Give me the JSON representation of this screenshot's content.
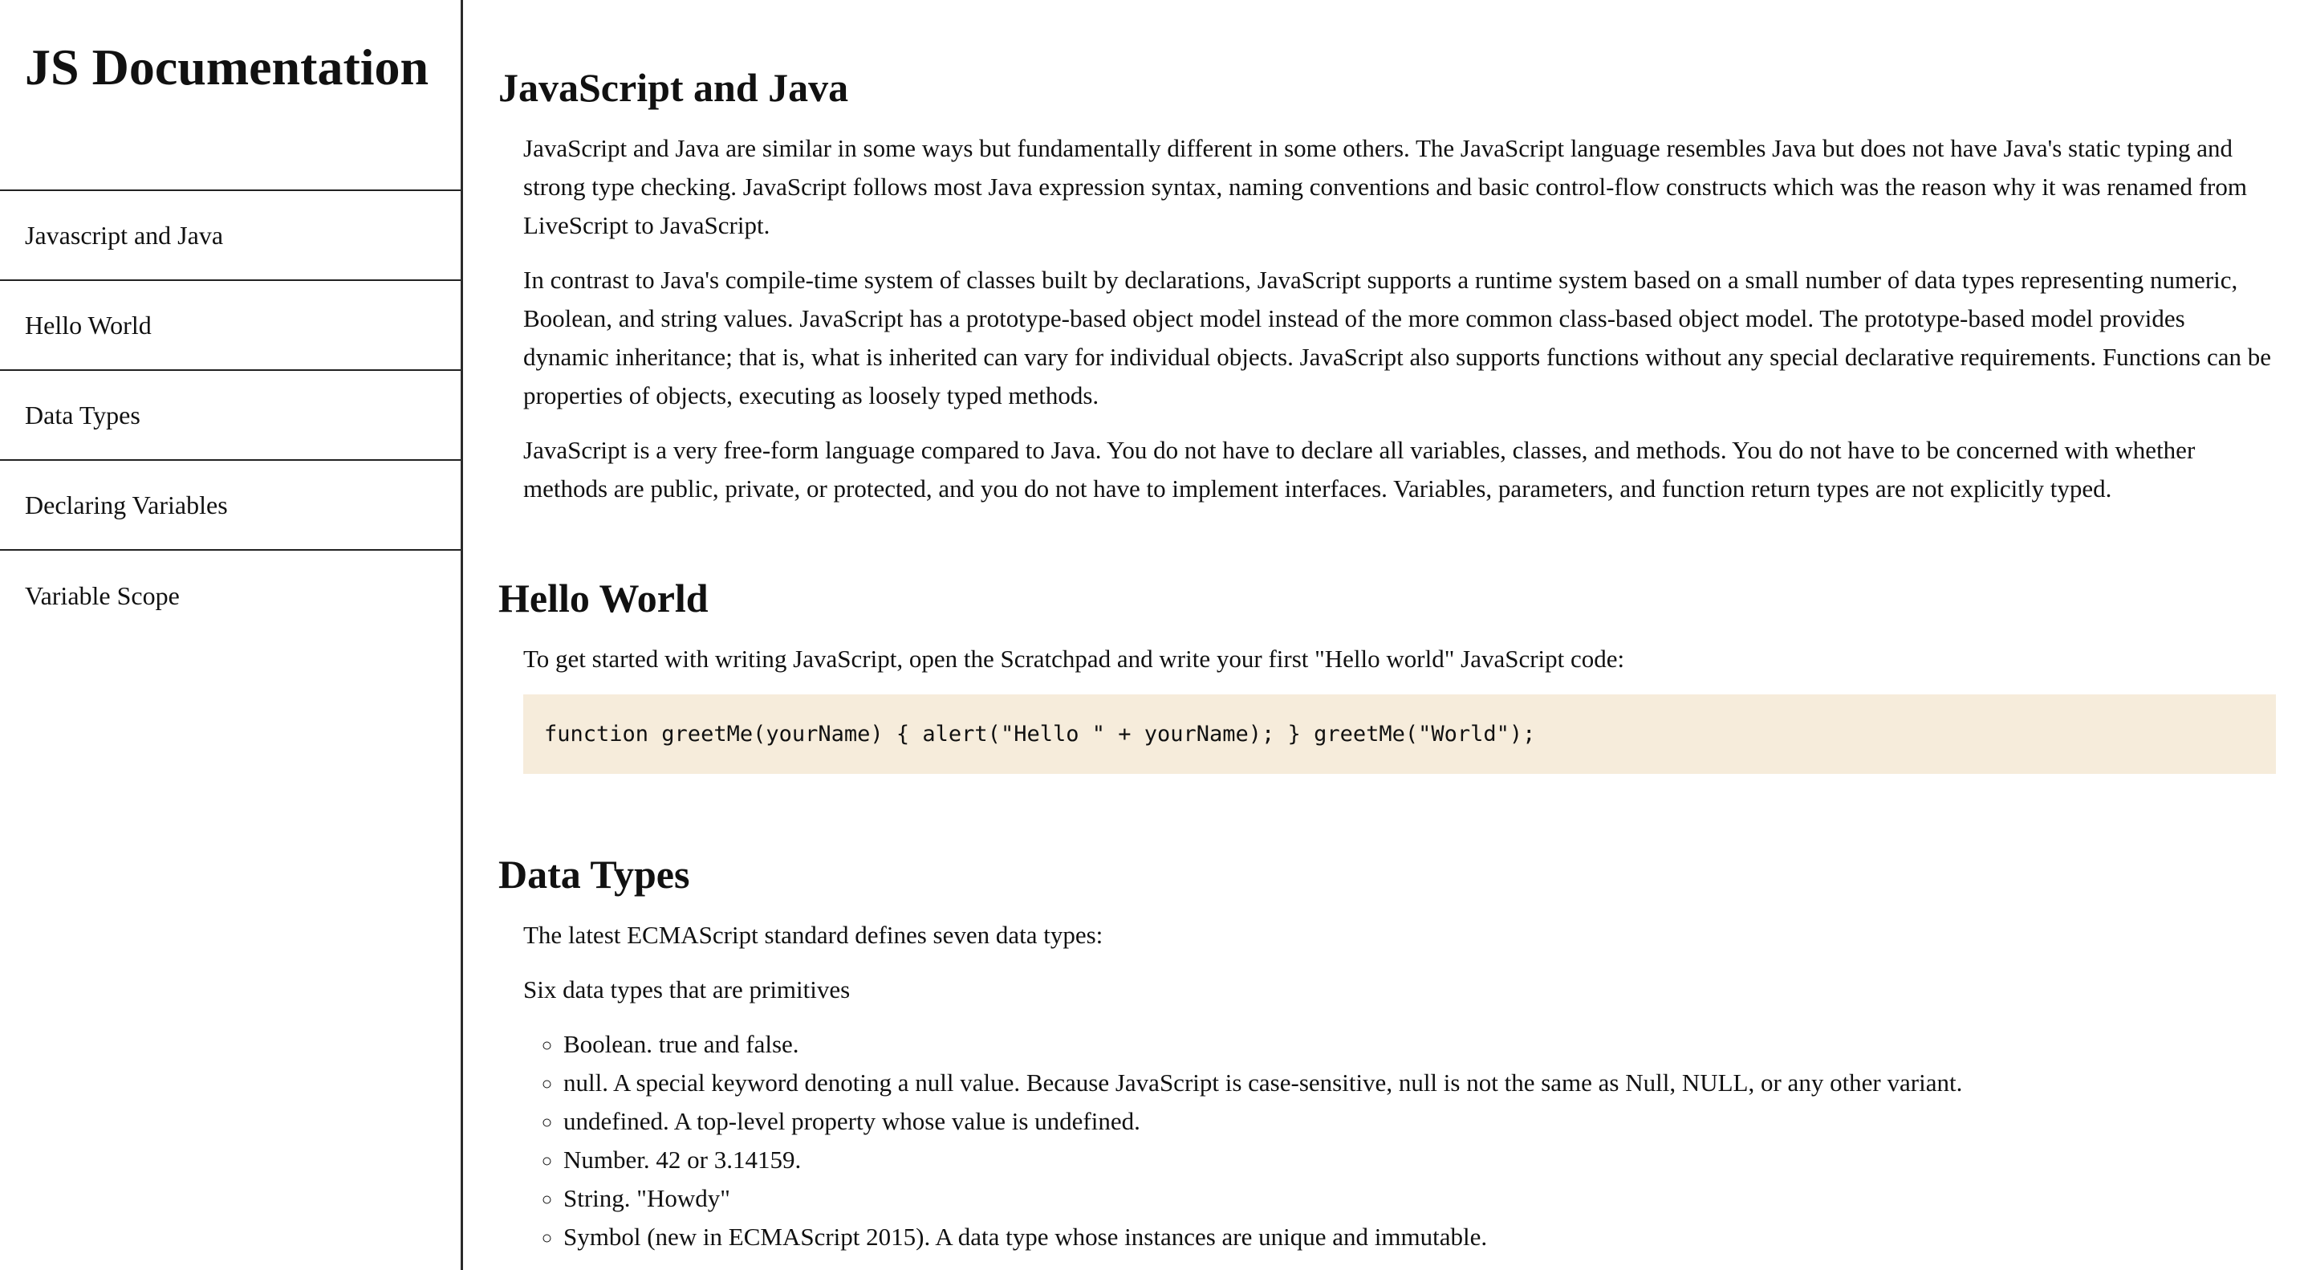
{
  "nav": {
    "title": "JS Documentation",
    "items": [
      {
        "label": "Javascript and Java"
      },
      {
        "label": "Hello World"
      },
      {
        "label": "Data Types"
      },
      {
        "label": "Declaring Variables"
      },
      {
        "label": "Variable Scope"
      }
    ]
  },
  "sections": {
    "js_java": {
      "title": "JavaScript and Java",
      "p1": "JavaScript and Java are similar in some ways but fundamentally different in some others. The JavaScript language resembles Java but does not have Java's static typing and strong type checking. JavaScript follows most Java expression syntax, naming conventions and basic control-flow constructs which was the reason why it was renamed from LiveScript to JavaScript.",
      "p2": "In contrast to Java's compile-time system of classes built by declarations, JavaScript supports a runtime system based on a small number of data types representing numeric, Boolean, and string values. JavaScript has a prototype-based object model instead of the more common class-based object model. The prototype-based model provides dynamic inheritance; that is, what is inherited can vary for individual objects. JavaScript also supports functions without any special declarative requirements. Functions can be properties of objects, executing as loosely typed methods.",
      "p3": "JavaScript is a very free-form language compared to Java. You do not have to declare all variables, classes, and methods. You do not have to be concerned with whether methods are public, private, or protected, and you do not have to implement interfaces. Variables, parameters, and function return types are not explicitly typed."
    },
    "hello_world": {
      "title": "Hello World",
      "p1": "To get started with writing JavaScript, open the Scratchpad and write your first \"Hello world\" JavaScript code:",
      "code": "function greetMe(yourName) { alert(\"Hello \" + yourName); } greetMe(\"World\");"
    },
    "data_types": {
      "title": "Data Types",
      "p1": "The latest ECMAScript standard defines seven data types:",
      "p2": "Six data types that are primitives",
      "items": [
        "Boolean. true and false.",
        "null. A special keyword denoting a null value. Because JavaScript is case-sensitive, null is not the same as Null, NULL, or any other variant.",
        "undefined. A top-level property whose value is undefined.",
        "Number. 42 or 3.14159.",
        "String. \"Howdy\"",
        "Symbol (new in ECMAScript 2015). A data type whose instances are unique and immutable."
      ]
    }
  }
}
